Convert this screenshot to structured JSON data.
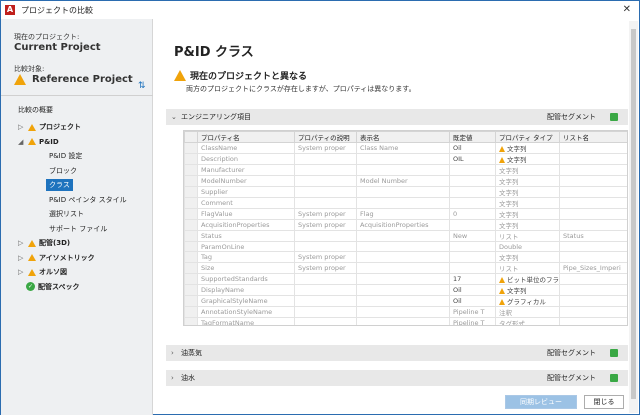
{
  "window": {
    "title": "プロジェクトの比較",
    "logo": "A"
  },
  "left": {
    "current_label": "現在のプロジェクト:",
    "current_name": "Current Project",
    "compare_label": "比較対象:",
    "reference_name": "Reference Project",
    "summary_title": "比較の概要",
    "tree": [
      {
        "label": "プロジェクト",
        "type": "warn",
        "arrow": "▷"
      },
      {
        "label": "P&ID",
        "type": "warn",
        "arrow": "◢"
      },
      {
        "label": "P&ID 設定",
        "type": "child"
      },
      {
        "label": "ブロック",
        "type": "child"
      },
      {
        "label": "クラス",
        "type": "child-selected"
      },
      {
        "label": "P&ID ペインタ スタイル",
        "type": "child"
      },
      {
        "label": "選択リスト",
        "type": "child"
      },
      {
        "label": "サポート ファイル",
        "type": "child"
      },
      {
        "label": "配管(3D)",
        "type": "warn",
        "arrow": "▷"
      },
      {
        "label": "アイソメトリック",
        "type": "warn",
        "arrow": "▷"
      },
      {
        "label": "オルソ図",
        "type": "warn",
        "arrow": "▷"
      },
      {
        "label": "配管スペック",
        "type": "ok"
      }
    ]
  },
  "main": {
    "title": "P&ID クラス",
    "subtitle": "現在のプロジェクトと異なる",
    "description": "両方のプロジェクトにクラスが存在しますが、プロパティは異なります。",
    "sections": [
      {
        "name": "エンジニアリング項目",
        "type": "配管セグメント",
        "chev": "⌄"
      },
      {
        "name": "油蒸気",
        "type": "配管セグメント",
        "chev": "›"
      },
      {
        "name": "油水",
        "type": "配管セグメント",
        "chev": "›"
      }
    ],
    "grid": {
      "columns": [
        "",
        "プロパティ名",
        "プロパティの説明",
        "表示名",
        "既定値",
        "プロパティ タイプ",
        "リスト名"
      ],
      "rows": [
        [
          "ClassName",
          "System proper",
          "Class Name",
          "Oil",
          "文字列",
          "",
          "warn",
          "dark"
        ],
        [
          "Description",
          "",
          "",
          "OIL",
          "文字列",
          "",
          "warn",
          "dark"
        ],
        [
          "Manufacturer",
          "",
          "",
          "",
          "文字列",
          "",
          "",
          ""
        ],
        [
          "ModelNumber",
          "",
          "Model Number",
          "",
          "文字列",
          "",
          "",
          ""
        ],
        [
          "Supplier",
          "",
          "",
          "",
          "文字列",
          "",
          "",
          ""
        ],
        [
          "Comment",
          "",
          "",
          "",
          "文字列",
          "",
          "",
          ""
        ],
        [
          "FlagValue",
          "System proper",
          "Flag",
          "0",
          "文字列",
          "",
          "",
          ""
        ],
        [
          "AcquisitionProperties",
          "System proper",
          "AcquisitionProperties",
          "",
          "文字列",
          "",
          "",
          ""
        ],
        [
          "Status",
          "",
          "",
          "New",
          "リスト",
          "Status",
          "",
          ""
        ],
        [
          "ParamOnLine",
          "",
          "",
          "",
          "Double",
          "",
          "",
          ""
        ],
        [
          "Tag",
          "System proper",
          "",
          "",
          "文字列",
          "",
          "",
          ""
        ],
        [
          "Size",
          "System proper",
          "",
          "",
          "リスト",
          "Pipe_Sizes_Imperi",
          "",
          ""
        ],
        [
          "SupportedStandards",
          "",
          "",
          "17",
          "ビット単位のフラグ",
          "",
          "warn",
          "dark"
        ],
        [
          "DisplayName",
          "",
          "",
          "Oil",
          "文字列",
          "",
          "warn",
          "dark"
        ],
        [
          "GraphicalStyleName",
          "",
          "",
          "Oil",
          "グラフィカル",
          "",
          "warn",
          "dark"
        ],
        [
          "AnnotationStyleName",
          "",
          "",
          "Pipeline T",
          "注釈",
          "",
          "",
          ""
        ],
        [
          "TagFormatName",
          "",
          "",
          "Pipeline T",
          "タグ形式",
          "",
          "",
          ""
        ]
      ]
    }
  },
  "buttons": {
    "review": "同期レビュー",
    "close": "閉じる"
  },
  "colors": {
    "accent": "#1e73be",
    "warning": "#f0a30a",
    "ok": "#3aa845"
  }
}
